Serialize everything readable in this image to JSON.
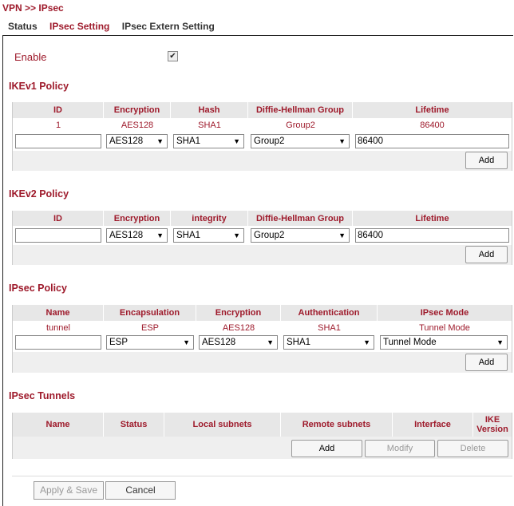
{
  "breadcrumb": "VPN >> IPsec",
  "tabs": [
    {
      "label": "Status",
      "active": false
    },
    {
      "label": "IPsec Setting",
      "active": true
    },
    {
      "label": "IPsec Extern Setting",
      "active": false
    }
  ],
  "enable": {
    "label": "Enable",
    "checked": true,
    "check_glyph": "✔"
  },
  "dropdown_glyph": "▼",
  "ikev1": {
    "title": "IKEv1 Policy",
    "headers": [
      "ID",
      "Encryption",
      "Hash",
      "Diffie-Hellman Group",
      "Lifetime"
    ],
    "row": [
      "1",
      "AES128",
      "SHA1",
      "Group2",
      "86400"
    ],
    "inputs": {
      "id": "",
      "encryption": "AES128",
      "hash": "SHA1",
      "dh": "Group2",
      "lifetime": "86400"
    },
    "add": "Add"
  },
  "ikev2": {
    "title": "IKEv2 Policy",
    "headers": [
      "ID",
      "Encryption",
      "integrity",
      "Diffie-Hellman Group",
      "Lifetime"
    ],
    "inputs": {
      "id": "",
      "encryption": "AES128",
      "integrity": "SHA1",
      "dh": "Group2",
      "lifetime": "86400"
    },
    "add": "Add"
  },
  "ipsec_policy": {
    "title": "IPsec Policy",
    "headers": [
      "Name",
      "Encapsulation",
      "Encryption",
      "Authentication",
      "IPsec Mode"
    ],
    "row": [
      "tunnel",
      "ESP",
      "AES128",
      "SHA1",
      "Tunnel Mode"
    ],
    "inputs": {
      "name": "",
      "encapsulation": "ESP",
      "encryption": "AES128",
      "authentication": "SHA1",
      "mode": "Tunnel Mode"
    },
    "add": "Add"
  },
  "tunnels": {
    "title": "IPsec Tunnels",
    "headers": [
      "Name",
      "Status",
      "Local subnets",
      "Remote subnets",
      "Interface",
      "IKE Version"
    ],
    "add": "Add",
    "modify": "Modify",
    "delete": "Delete"
  },
  "footer": {
    "apply": "Apply & Save",
    "cancel": "Cancel"
  }
}
